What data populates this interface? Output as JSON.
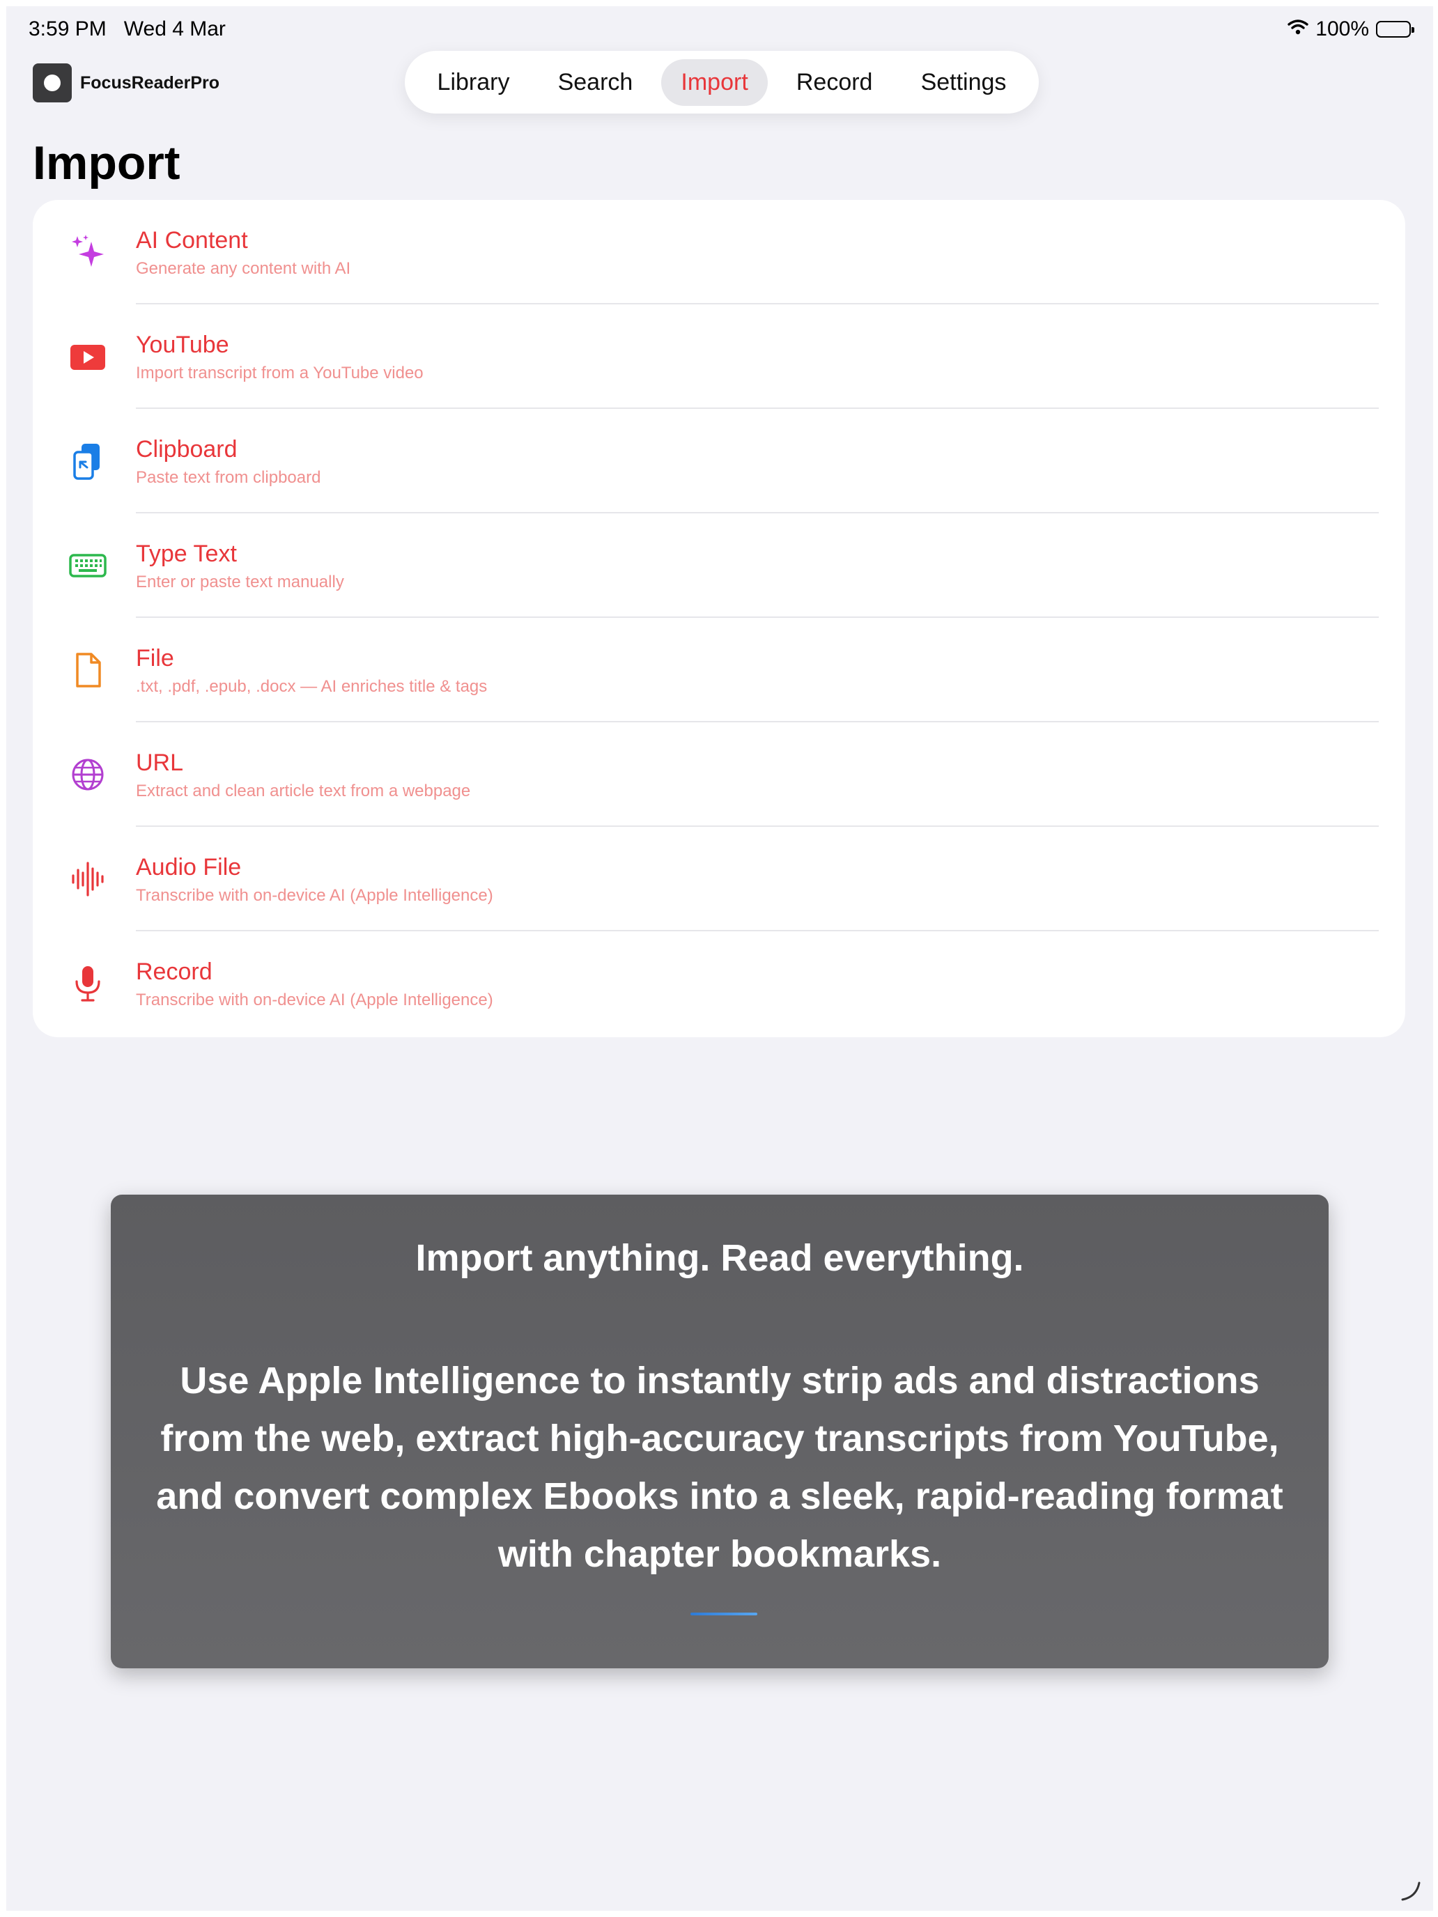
{
  "status_bar": {
    "time": "3:59 PM",
    "date": "Wed 4 Mar",
    "battery": "100%"
  },
  "app": {
    "name": "FocusReaderPro"
  },
  "tabs": [
    {
      "label": "Library",
      "active": false
    },
    {
      "label": "Search",
      "active": false
    },
    {
      "label": "Import",
      "active": true
    },
    {
      "label": "Record",
      "active": false
    },
    {
      "label": "Settings",
      "active": false
    }
  ],
  "page": {
    "title": "Import"
  },
  "import_items": [
    {
      "icon": "sparkles-icon",
      "title": "AI Content",
      "subtitle": "Generate any content with AI",
      "color": "#c43de0"
    },
    {
      "icon": "youtube-icon",
      "title": "YouTube",
      "subtitle": "Import transcript from a YouTube video",
      "color": "#ee3b3b"
    },
    {
      "icon": "clipboard-icon",
      "title": "Clipboard",
      "subtitle": "Paste text from clipboard",
      "color": "#1a7ee6"
    },
    {
      "icon": "keyboard-icon",
      "title": "Type Text",
      "subtitle": "Enter or paste text manually",
      "color": "#2db84d"
    },
    {
      "icon": "file-icon",
      "title": "File",
      "subtitle": ".txt, .pdf, .epub, .docx — AI enriches title & tags",
      "color": "#f08a24"
    },
    {
      "icon": "globe-icon",
      "title": "URL",
      "subtitle": "Extract and clean article text from a webpage",
      "color": "#b23fd0"
    },
    {
      "icon": "waveform-icon",
      "title": "Audio File",
      "subtitle": "Transcribe with on-device AI (Apple Intelligence)",
      "color": "#e8363a"
    },
    {
      "icon": "microphone-icon",
      "title": "Record",
      "subtitle": "Transcribe with on-device AI (Apple Intelligence)",
      "color": "#e8363a"
    }
  ],
  "overlay": {
    "headline": "Import anything. Read everything.",
    "body": "Use Apple Intelligence to instantly strip ads and distractions from the web, extract high-accuracy transcripts from YouTube, and convert complex Ebooks into a sleek, rapid-reading format with chapter bookmarks."
  },
  "colors": {
    "accent": "#e8363a",
    "background": "#f2f2f7"
  }
}
